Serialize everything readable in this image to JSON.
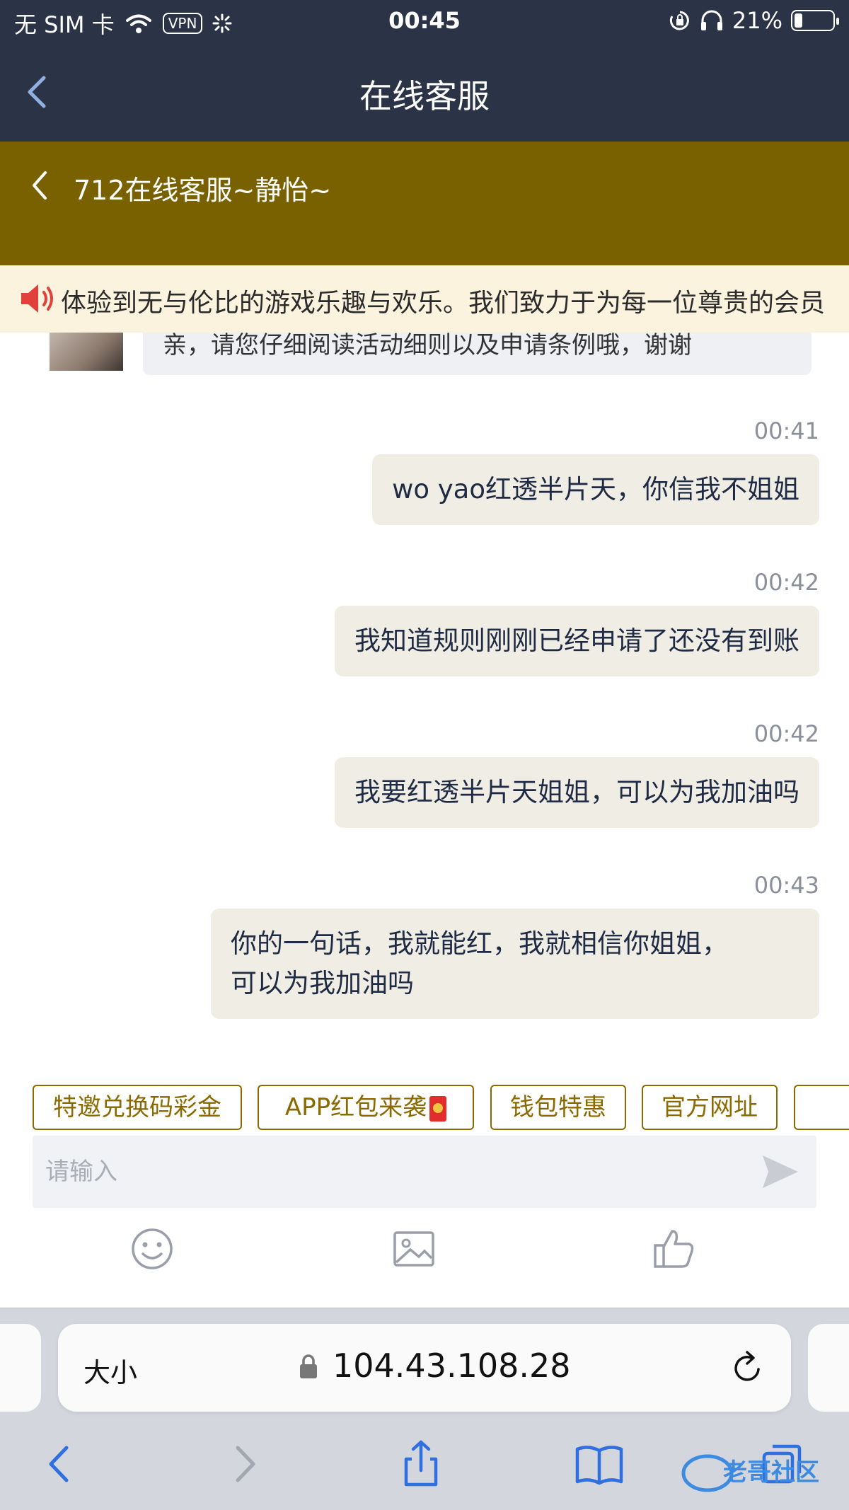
{
  "status_bar": {
    "carrier": "无 SIM 卡",
    "vpn": "VPN",
    "time": "00:45",
    "battery": "21%",
    "battery_level": 0.21
  },
  "nav": {
    "title": "在线客服"
  },
  "chat_header": {
    "title": "712在线客服~静怡~"
  },
  "announcement": {
    "text": "体验到无与伦比的游戏乐趣与欢乐。我们致力于为每一位尊贵的会员"
  },
  "incoming": {
    "text": "亲，请您仔细阅读活动细则以及申请条例哦，谢谢"
  },
  "messages": [
    {
      "time": "00:41",
      "text": "wo yao红透半片天，你信我不姐姐"
    },
    {
      "time": "00:42",
      "text": "我知道规则刚刚已经申请了还没有到账"
    },
    {
      "time": "00:42",
      "text": "我要红透半片天姐姐，可以为我加油吗"
    },
    {
      "time": "00:43",
      "text": "你的一句话，我就能红，我就相信你姐姐，",
      "text2": "可以为我加油吗"
    }
  ],
  "quick_replies": [
    "特邀兑换码彩金",
    "APP红包来袭",
    "钱包特惠",
    "官方网址"
  ],
  "input": {
    "placeholder": "请输入"
  },
  "browser": {
    "text_size": "大小",
    "url": "104.43.108.28"
  },
  "watermark": {
    "text": "老哥社区"
  },
  "colors": {
    "nav_bg": "#2b3447",
    "chat_header_bg": "#7a6100",
    "marquee_bg": "#fbf3de",
    "bubble_bg": "#efede4",
    "accent": "#8a6a00"
  }
}
